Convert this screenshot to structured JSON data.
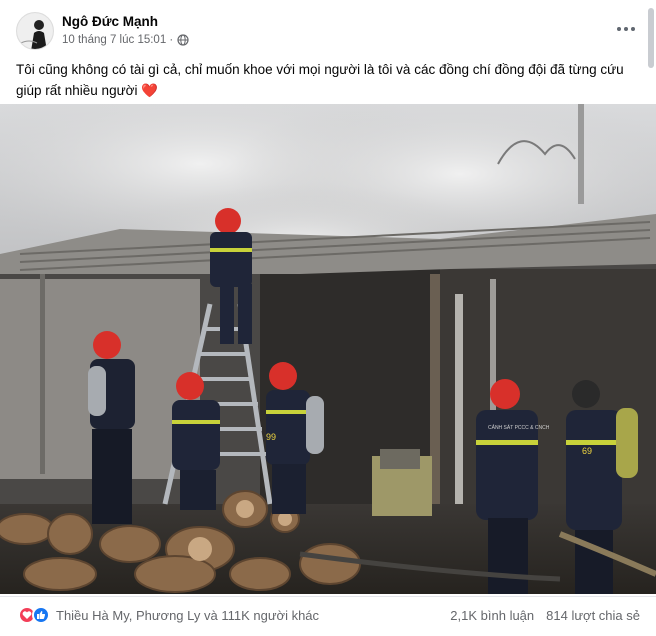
{
  "post": {
    "author": "Ngô Đức Mạnh",
    "timestamp": "10 tháng 7 lúc 15:01 ·",
    "privacy_icon": "globe-icon",
    "text": "Tôi cũng không có tài gì cả, chỉ muốn khoe với mọi người là  tôi và các đồng chí đồng đội đã từng cứu giúp rất nhiều người",
    "text_emoji": "❤️",
    "photo_description_icon": "firefighters-photo",
    "photo_vest_text": "CẢNH SÁT PCCC & CNCH",
    "photo_helmet_numbers": [
      "99",
      "69"
    ]
  },
  "footer": {
    "reaction_icons": [
      "love-icon",
      "like-icon"
    ],
    "reactors": "Thiều Hà My, Phương Ly và 111K người khác",
    "comments": "2,1K bình luận",
    "shares": "814 lượt chia sẻ"
  },
  "colors": {
    "name": "#050505",
    "meta": "#65676b",
    "like": "#1877f2",
    "love": "#f33e58"
  }
}
